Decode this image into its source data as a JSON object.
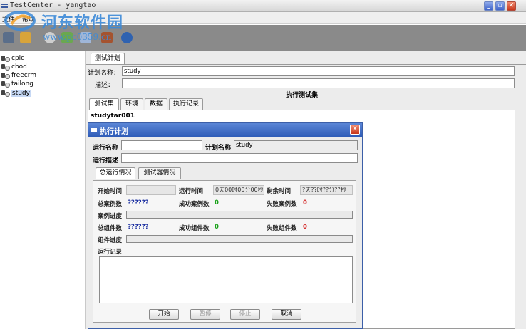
{
  "window": {
    "title": "TestCenter - yangtao",
    "min_label": "_",
    "max_label": "▫",
    "close_label": "✕"
  },
  "menu": [
    "文件",
    "帮助"
  ],
  "watermark": {
    "title": "河东软件园",
    "url": "www.pc0359.cn"
  },
  "toolbar": {
    "icons": [
      "new-icon",
      "open-icon",
      "wrench-icon",
      "bug-icon",
      "tools-icon",
      "users-icon",
      "user-icon"
    ]
  },
  "tree": {
    "items": [
      "cpic",
      "cbod",
      "freecrm",
      "tailong",
      "study"
    ],
    "selected": "study"
  },
  "plan": {
    "tab": "测试计划",
    "name_label": "计划名称：",
    "name_value": "study",
    "desc_label": "描述：",
    "desc_value": "",
    "exec_label": "执行测试集",
    "subtabs": [
      "测试集",
      "环境",
      "数据",
      "执行记录"
    ],
    "active_subtab": "测试集",
    "list_first": "studytar001"
  },
  "dialog": {
    "title": "执行计划",
    "close_label": "✕",
    "run_name_label": "运行名称",
    "run_name_value": "",
    "plan_name_label": "计划名称",
    "plan_name_value": "study",
    "run_desc_label": "运行描述",
    "run_desc_value": "",
    "tabs": [
      "总运行情况",
      "测试器情况"
    ],
    "active_tab": "总运行情况",
    "start_time_label": "开始时间",
    "start_time_value": "",
    "run_time_label": "运行时间",
    "run_time_value": "0天00时00分00秒",
    "remain_label": "剩余时间",
    "remain_value": "?天??时??分??秒",
    "total_cases_label": "总案例数",
    "total_cases_value": "??????",
    "success_cases_label": "成功案例数",
    "success_cases_value": "0",
    "success_color": "#1aa21a",
    "fail_cases_label": "失败案例数",
    "fail_cases_value": "0",
    "fail_color": "#d11a1a",
    "case_progress_label": "案例进度",
    "case_progress": 0,
    "total_comp_label": "总组件数",
    "total_comp_value": "??????",
    "success_comp_label": "成功组件数",
    "success_comp_value": "0",
    "fail_comp_label": "失败组件数",
    "fail_comp_value": "0",
    "comp_progress_label": "组件进度",
    "comp_progress": 0,
    "log_label": "运行记录",
    "buttons": {
      "start": "开始",
      "pause": "暂停",
      "stop": "停止",
      "cancel": "取消"
    }
  }
}
